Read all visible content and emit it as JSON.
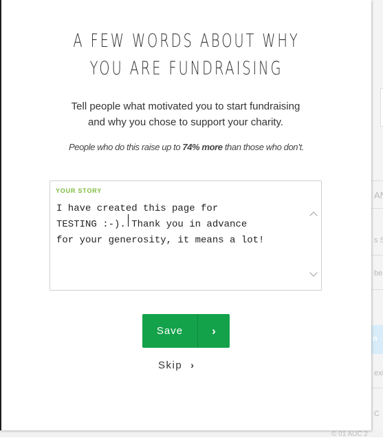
{
  "modal": {
    "title_line1": "A FEW WORDS ABOUT WHY",
    "title_line2": "YOU ARE FUNDRAISING",
    "intro_line1": "Tell people what motivated you to start fundraising",
    "intro_line2": "and why you chose to support your charity.",
    "stat_prefix": "People who do this raise up to ",
    "stat_highlight": "74% more",
    "stat_suffix": " than those who don’t."
  },
  "story": {
    "label": "YOUR STORY",
    "value": "I have created this page for\nTESTING :-). Thank you in advance\nfor your generosity, it means a lot!"
  },
  "actions": {
    "save_label": "Save",
    "save_arrow": "›",
    "skip_label": "Skip",
    "skip_arrow": "›"
  },
  "background": {
    "fragments": [
      "AN",
      "s Su",
      "ber",
      "n",
      "exi",
      "C"
    ],
    "footer_fragment": "© 01 AUC 2"
  },
  "colors": {
    "accent_green": "#13a24a",
    "label_green": "#7dbb3c"
  }
}
